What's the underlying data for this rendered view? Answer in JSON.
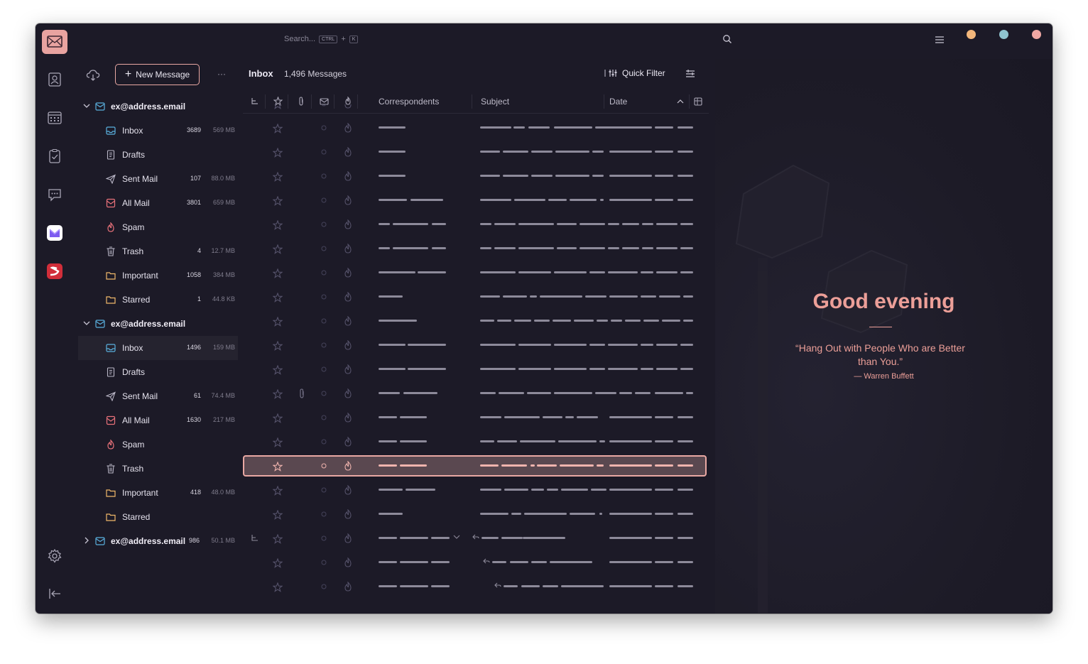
{
  "search": {
    "placeholder": "Search...",
    "kbd_ctrl": "CTRL",
    "kbd_plus": "+",
    "kbd_k": "K"
  },
  "window_dots": [
    "#f3b77b",
    "#8fc4cf",
    "#f0a8a4"
  ],
  "folder_pane": {
    "new_message": "New Message",
    "more": "···",
    "accounts": [
      {
        "label": "ex@address.email",
        "expanded": true,
        "folders": [
          {
            "label": "Inbox",
            "icon": "inbox-icon",
            "count": "3689",
            "size": "569 MB"
          },
          {
            "label": "Drafts",
            "icon": "drafts-icon",
            "count": "",
            "size": ""
          },
          {
            "label": "Sent Mail",
            "icon": "sent-icon",
            "count": "107",
            "size": "88.0 MB"
          },
          {
            "label": "All Mail",
            "icon": "all-mail-icon",
            "count": "3801",
            "size": "659 MB"
          },
          {
            "label": "Spam",
            "icon": "spam-icon",
            "count": "",
            "size": ""
          },
          {
            "label": "Trash",
            "icon": "trash-icon",
            "count": "4",
            "size": "12.7 MB"
          },
          {
            "label": "Important",
            "icon": "folder-icon",
            "count": "1058",
            "size": "384 MB"
          },
          {
            "label": "Starred",
            "icon": "folder-icon",
            "count": "1",
            "size": "44.8 KB"
          }
        ]
      },
      {
        "label": "ex@address.email",
        "expanded": true,
        "folders": [
          {
            "label": "Inbox",
            "icon": "inbox-icon",
            "count": "1496",
            "size": "159 MB",
            "selected": true
          },
          {
            "label": "Drafts",
            "icon": "drafts-icon",
            "count": "",
            "size": ""
          },
          {
            "label": "Sent Mail",
            "icon": "sent-icon",
            "count": "61",
            "size": "74.4 MB"
          },
          {
            "label": "All Mail",
            "icon": "all-mail-icon",
            "count": "1630",
            "size": "217 MB"
          },
          {
            "label": "Spam",
            "icon": "spam-icon",
            "count": "",
            "size": ""
          },
          {
            "label": "Trash",
            "icon": "trash-icon",
            "count": "",
            "size": ""
          },
          {
            "label": "Important",
            "icon": "folder-icon",
            "count": "418",
            "size": "48.0 MB"
          },
          {
            "label": "Starred",
            "icon": "folder-icon",
            "count": "",
            "size": ""
          }
        ]
      },
      {
        "label": "ex@address.email",
        "expanded": false,
        "count": "986",
        "size": "50.1 MB",
        "folders": []
      }
    ]
  },
  "message_list": {
    "title": "Inbox",
    "count": "1,496 Messages",
    "quick_filter": "Quick Filter",
    "columns": {
      "correspondents": "Correspondents",
      "subject": "Subject",
      "date": "Date"
    }
  },
  "preview": {
    "greeting": "Good evening",
    "quote": "“Hang Out with People Who are Better than You.”",
    "author": "— Warren Buffett"
  },
  "colors": {
    "accent": "#e9a8a3",
    "background": "#1c1a27",
    "text": "#e4e1ec"
  }
}
